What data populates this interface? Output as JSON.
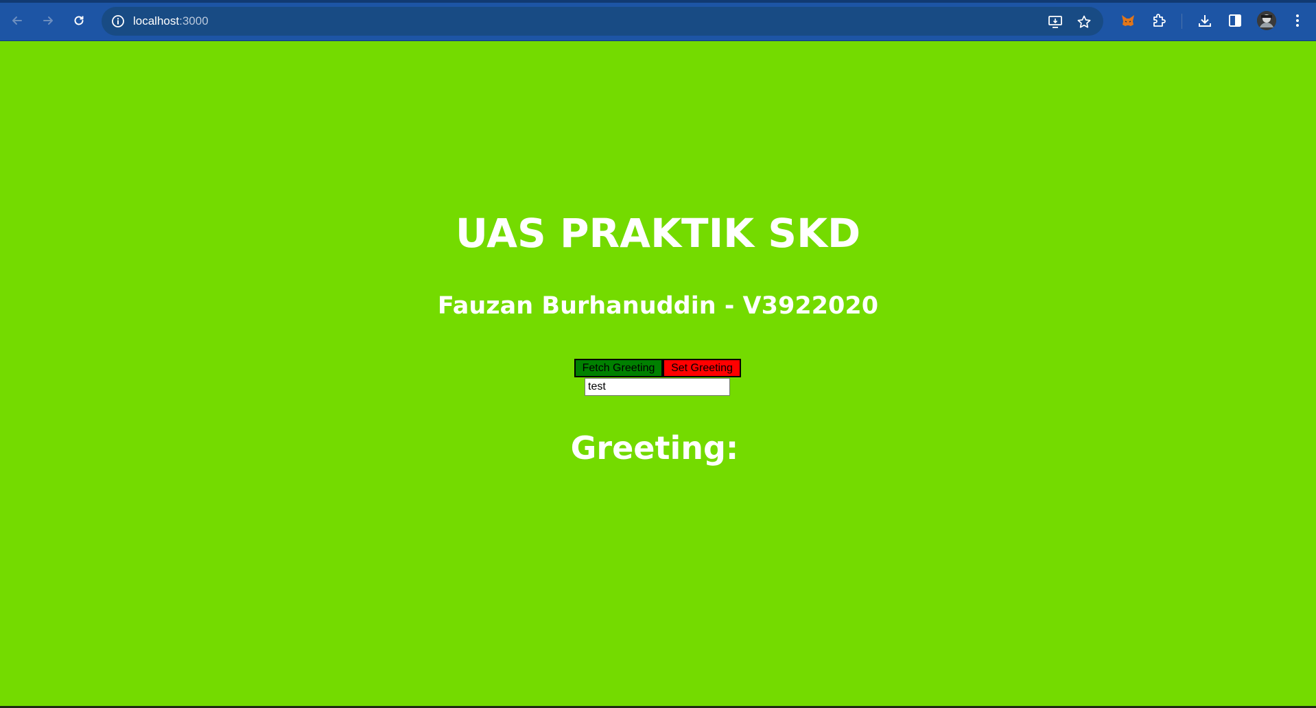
{
  "browser": {
    "url_host": "localhost",
    "url_port": ":3000",
    "back_icon": "arrow-left-icon",
    "forward_icon": "arrow-right-icon",
    "reload_icon": "reload-icon",
    "site_info_icon": "info-icon",
    "install_icon": "install-app-icon",
    "bookmark_icon": "star-icon",
    "metamask_icon": "fox-extension-icon",
    "extensions_icon": "puzzle-icon",
    "downloads_icon": "download-icon",
    "sidepanel_icon": "side-panel-icon",
    "menu_icon": "kebab-menu-icon",
    "chrome_color": "#1d55a5"
  },
  "page": {
    "background_color": "#74db00",
    "title": "UAS PRAKTIK SKD",
    "subtitle": "Fauzan Burhanuddin - V3922020",
    "fetch_button_label": "Fetch Greeting",
    "set_button_label": "Set Greeting",
    "greeting_input_value": "test",
    "greeting_label": "Greeting:",
    "greeting_value": ""
  }
}
